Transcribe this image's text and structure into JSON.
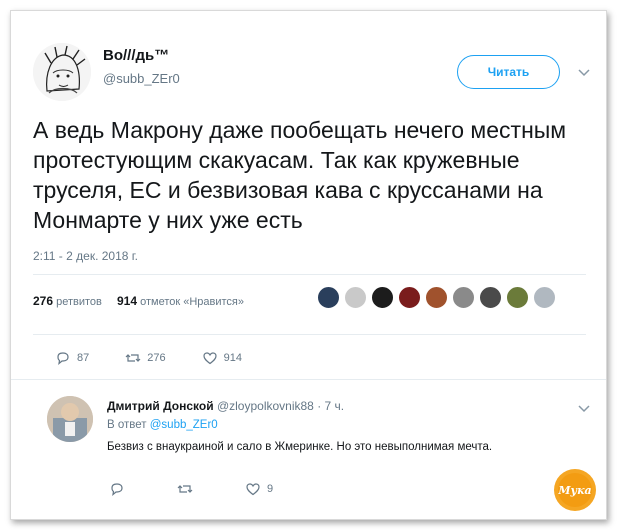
{
  "user": {
    "name": "Во///дь™",
    "handle": "@subb_ZEr0",
    "follow_label": "Читать"
  },
  "tweet": {
    "text": "А ведь Макрону даже пообещать нечего местным протестующим скакуасам. Так как кружевные труселя, ЕС и безвизовая кава с круссанами на Монмарте у них уже есть",
    "timestamp": "2:11 - 2 дек. 2018 г."
  },
  "stats": {
    "retweets_count": "276",
    "retweets_label": "ретвитов",
    "likes_count": "914",
    "likes_label": "отметок «Нравится»"
  },
  "likers": [
    "#2a3f5c",
    "#c9c9c9",
    "#1c1c1c",
    "#7a1c1c",
    "#a0522d",
    "#8a8a8a",
    "#4a4a4a",
    "#6b7b3a",
    "#b0b8c0"
  ],
  "actions": {
    "replies": "87",
    "retweets": "276",
    "likes": "914"
  },
  "reply": {
    "name": "Дмитрий Донской",
    "handle": "@zloypolkovnik88",
    "time": "· 7 ч.",
    "reply_to_label": "В ответ",
    "reply_to_handle": "@subb_ZEr0",
    "text": "Безвиз с внаукраиной и сало в Жмеринке. Но это невыполнимая мечта.",
    "likes": "9"
  },
  "colors": {
    "accent": "#1da1f2",
    "muted": "#657786",
    "text": "#14171a",
    "divider": "#e6ecf0"
  },
  "icons": [
    "chevron-down-icon",
    "reply-icon",
    "retweet-icon",
    "like-icon"
  ],
  "watermark": {
    "text": "Мука"
  }
}
